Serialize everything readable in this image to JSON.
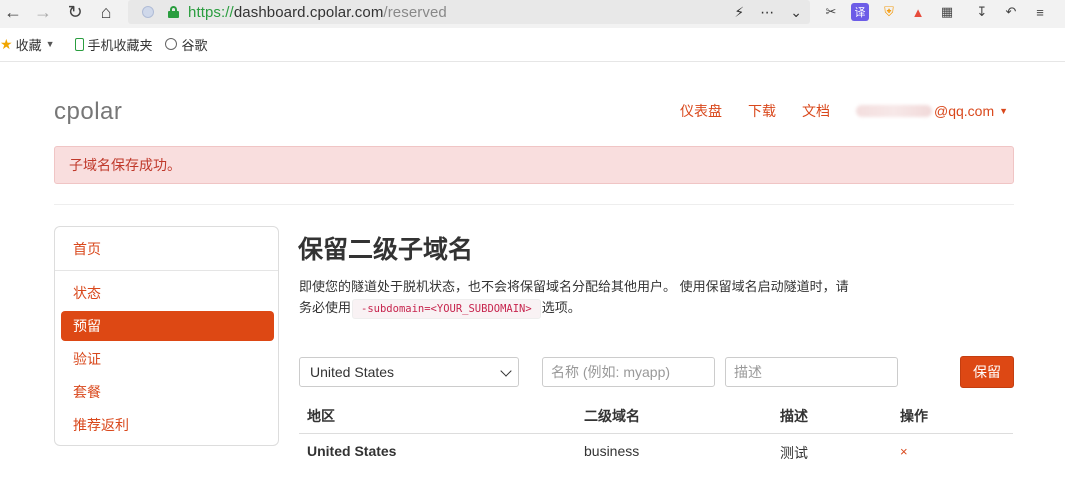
{
  "browser": {
    "url_scheme": "https://",
    "url_host": "dashboard.cpolar.com",
    "url_path": "/reserved",
    "bookmarks": [
      {
        "label": "收藏"
      },
      {
        "label": "手机收藏夹"
      },
      {
        "label": "谷歌"
      }
    ],
    "extensions": {
      "translate": "译"
    }
  },
  "header": {
    "logo": "cpolar",
    "nav": [
      "仪表盘",
      "下载",
      "文档"
    ],
    "user_email_suffix": "@qq.com"
  },
  "alert": {
    "message": "子域名保存成功。",
    "color": "#c0392b"
  },
  "sidebar": {
    "items": [
      {
        "label": "首页",
        "active": false
      },
      {
        "label": "状态",
        "active": false
      },
      {
        "label": "预留",
        "active": true
      },
      {
        "label": "验证",
        "active": false
      },
      {
        "label": "套餐",
        "active": false
      },
      {
        "label": "推荐返利",
        "active": false
      }
    ],
    "accent": "#dd4814"
  },
  "main": {
    "title": "保留二级子域名",
    "desc_part1": "即使您的隧道处于脱机状态，也不会将保留域名分配给其他用户。 使用保留域名启动隧道时，请务必使用",
    "desc_code": "-subdomain=<YOUR_SUBDOMAIN>",
    "desc_part2": "选项。",
    "form": {
      "region_selected": "United States",
      "name_placeholder": "名称 (例如: myapp)",
      "desc_placeholder": "描述",
      "save_label": "保留"
    },
    "table": {
      "headers": [
        "地区",
        "二级域名",
        "描述",
        "操作"
      ],
      "rows": [
        {
          "region": "United States",
          "subdomain": "business",
          "description": "测试",
          "action": "×"
        }
      ]
    }
  }
}
